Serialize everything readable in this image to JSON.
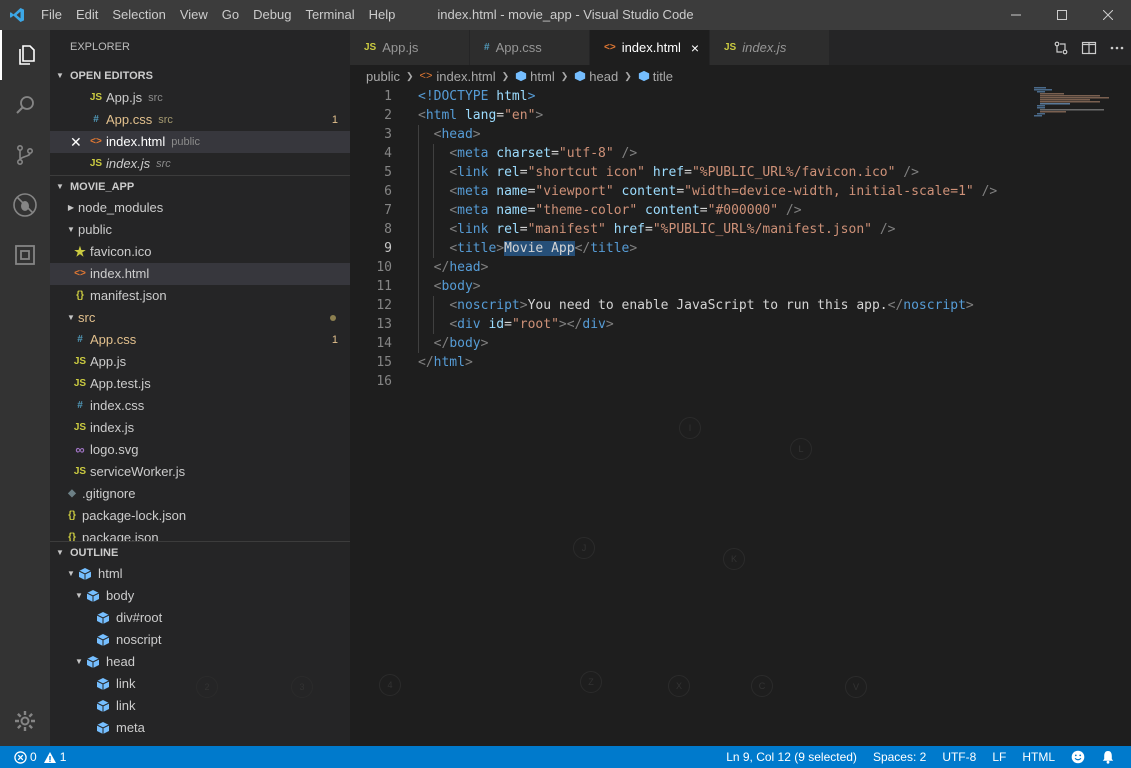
{
  "window": {
    "title": "index.html - movie_app - Visual Studio Code",
    "menu": [
      "File",
      "Edit",
      "Selection",
      "View",
      "Go",
      "Debug",
      "Terminal",
      "Help"
    ]
  },
  "activity": [
    "files-icon",
    "search-icon",
    "source-control-icon",
    "debug-icon",
    "extensions-icon",
    "gear-icon"
  ],
  "sidebar": {
    "title": "EXPLORER",
    "open_editors": {
      "header": "OPEN EDITORS",
      "items": [
        {
          "icon": "JS",
          "name": "App.js",
          "desc": "src",
          "badge": ""
        },
        {
          "icon": "#",
          "name": "App.css",
          "desc": "src",
          "badge": "1"
        },
        {
          "icon": "<>",
          "name": "index.html",
          "desc": "public",
          "badge": ""
        },
        {
          "icon": "JS",
          "name": "index.js",
          "desc": "src",
          "badge": ""
        }
      ]
    },
    "project": {
      "header": "MOVIE_APP",
      "items": [
        {
          "name": "node_modules"
        },
        {
          "name": "public"
        },
        {
          "icon": "★",
          "name": "favicon.ico"
        },
        {
          "icon": "<>",
          "name": "index.html"
        },
        {
          "icon": "{}",
          "name": "manifest.json"
        },
        {
          "name": "src"
        },
        {
          "icon": "#",
          "name": "App.css",
          "badge": "1"
        },
        {
          "icon": "JS",
          "name": "App.js"
        },
        {
          "icon": "JS",
          "name": "App.test.js"
        },
        {
          "icon": "#",
          "name": "index.css"
        },
        {
          "icon": "JS",
          "name": "index.js"
        },
        {
          "icon": "∞",
          "name": "logo.svg"
        },
        {
          "icon": "JS",
          "name": "serviceWorker.js"
        },
        {
          "icon": "◆",
          "name": ".gitignore"
        },
        {
          "icon": "{}",
          "name": "package-lock.json"
        },
        {
          "icon": "{}",
          "name": "package.json"
        }
      ]
    },
    "outline": {
      "header": "OUTLINE",
      "items": [
        "html",
        "body",
        "div#root",
        "noscript",
        "head",
        "link",
        "link",
        "meta"
      ]
    }
  },
  "tabs": [
    {
      "icon": "JS",
      "label": "App.js"
    },
    {
      "icon": "#",
      "label": "App.css"
    },
    {
      "icon": "<>",
      "label": "index.html",
      "close": "×"
    },
    {
      "icon": "JS",
      "label": "index.js"
    }
  ],
  "breadcrumbs": [
    "public",
    "index.html",
    "html",
    "head",
    "title"
  ],
  "editor": {
    "line_numbers": [
      "1",
      "2",
      "3",
      "4",
      "5",
      "6",
      "7",
      "8",
      "9",
      "10",
      "11",
      "12",
      "13",
      "14",
      "15",
      "16"
    ],
    "lines": [
      [
        [
          "t-tag",
          "<!DOCTYPE "
        ],
        [
          "t-attr",
          "html"
        ],
        [
          "t-tag",
          ">"
        ]
      ],
      [
        [
          "t-punc",
          "<"
        ],
        [
          "t-tag",
          "html "
        ],
        [
          "t-attr",
          "lang"
        ],
        [
          "t-txt",
          "="
        ],
        [
          "t-str",
          "\"en\""
        ],
        [
          "t-punc",
          ">"
        ]
      ],
      [
        [
          "t-txt",
          "  "
        ],
        [
          "t-punc",
          "<"
        ],
        [
          "t-tag",
          "head"
        ],
        [
          "t-punc",
          ">"
        ]
      ],
      [
        [
          "t-txt",
          "    "
        ],
        [
          "t-punc",
          "<"
        ],
        [
          "t-tag",
          "meta "
        ],
        [
          "t-attr",
          "charset"
        ],
        [
          "t-txt",
          "="
        ],
        [
          "t-str",
          "\"utf-8\""
        ],
        [
          "t-txt",
          " "
        ],
        [
          "t-punc",
          "/>"
        ]
      ],
      [
        [
          "t-txt",
          "    "
        ],
        [
          "t-punc",
          "<"
        ],
        [
          "t-tag",
          "link "
        ],
        [
          "t-attr",
          "rel"
        ],
        [
          "t-txt",
          "="
        ],
        [
          "t-str",
          "\"shortcut icon\""
        ],
        [
          "t-txt",
          " "
        ],
        [
          "t-attr",
          "href"
        ],
        [
          "t-txt",
          "="
        ],
        [
          "t-str",
          "\"%PUBLIC_URL%/favicon.ico\""
        ],
        [
          "t-txt",
          " "
        ],
        [
          "t-punc",
          "/>"
        ]
      ],
      [
        [
          "t-txt",
          "    "
        ],
        [
          "t-punc",
          "<"
        ],
        [
          "t-tag",
          "meta "
        ],
        [
          "t-attr",
          "name"
        ],
        [
          "t-txt",
          "="
        ],
        [
          "t-str",
          "\"viewport\""
        ],
        [
          "t-txt",
          " "
        ],
        [
          "t-attr",
          "content"
        ],
        [
          "t-txt",
          "="
        ],
        [
          "t-str",
          "\"width=device-width, initial-scale=1\""
        ],
        [
          "t-txt",
          " "
        ],
        [
          "t-punc",
          "/>"
        ]
      ],
      [
        [
          "t-txt",
          "    "
        ],
        [
          "t-punc",
          "<"
        ],
        [
          "t-tag",
          "meta "
        ],
        [
          "t-attr",
          "name"
        ],
        [
          "t-txt",
          "="
        ],
        [
          "t-str",
          "\"theme-color\""
        ],
        [
          "t-txt",
          " "
        ],
        [
          "t-attr",
          "content"
        ],
        [
          "t-txt",
          "="
        ],
        [
          "t-str",
          "\"#000000\""
        ],
        [
          "t-txt",
          " "
        ],
        [
          "t-punc",
          "/>"
        ]
      ],
      [
        [
          "t-txt",
          "    "
        ],
        [
          "t-punc",
          "<"
        ],
        [
          "t-tag",
          "link "
        ],
        [
          "t-attr",
          "rel"
        ],
        [
          "t-txt",
          "="
        ],
        [
          "t-str",
          "\"manifest\""
        ],
        [
          "t-txt",
          " "
        ],
        [
          "t-attr",
          "href"
        ],
        [
          "t-txt",
          "="
        ],
        [
          "t-str",
          "\"%PUBLIC_URL%/manifest.json\""
        ],
        [
          "t-txt",
          " "
        ],
        [
          "t-punc",
          "/>"
        ]
      ],
      [
        [
          "t-txt",
          "    "
        ],
        [
          "t-punc",
          "<"
        ],
        [
          "t-tag",
          "title"
        ],
        [
          "t-punc",
          ">"
        ],
        [
          "t-sel",
          "Movie App"
        ],
        [
          "t-punc",
          "</"
        ],
        [
          "t-tag",
          "title"
        ],
        [
          "t-punc",
          ">"
        ]
      ],
      [
        [
          "t-txt",
          "  "
        ],
        [
          "t-punc",
          "</"
        ],
        [
          "t-tag",
          "head"
        ],
        [
          "t-punc",
          ">"
        ]
      ],
      [
        [
          "t-txt",
          "  "
        ],
        [
          "t-punc",
          "<"
        ],
        [
          "t-tag",
          "body"
        ],
        [
          "t-punc",
          ">"
        ]
      ],
      [
        [
          "t-txt",
          "    "
        ],
        [
          "t-punc",
          "<"
        ],
        [
          "t-tag",
          "noscript"
        ],
        [
          "t-punc",
          ">"
        ],
        [
          "t-txt",
          "You need to enable JavaScript to run this app."
        ],
        [
          "t-punc",
          "</"
        ],
        [
          "t-tag",
          "noscript"
        ],
        [
          "t-punc",
          ">"
        ]
      ],
      [
        [
          "t-txt",
          "    "
        ],
        [
          "t-punc",
          "<"
        ],
        [
          "t-tag",
          "div "
        ],
        [
          "t-attr",
          "id"
        ],
        [
          "t-txt",
          "="
        ],
        [
          "t-str",
          "\"root\""
        ],
        [
          "t-punc",
          "></"
        ],
        [
          "t-tag",
          "div"
        ],
        [
          "t-punc",
          ">"
        ]
      ],
      [
        [
          "t-txt",
          "  "
        ],
        [
          "t-punc",
          "</"
        ],
        [
          "t-tag",
          "body"
        ],
        [
          "t-punc",
          ">"
        ]
      ],
      [
        [
          "t-punc",
          "</"
        ],
        [
          "t-tag",
          "html"
        ],
        [
          "t-punc",
          ">"
        ]
      ],
      []
    ],
    "current_line": "9"
  },
  "hints": [
    "I",
    "L",
    "J",
    "K",
    "2",
    "3",
    "4",
    "Z",
    "X",
    "C",
    "V"
  ],
  "status": {
    "errors": "0",
    "warnings": "1",
    "position": "Ln 9, Col 12 (9 selected)",
    "spaces": "Spaces: 2",
    "encoding": "UTF-8",
    "eol": "LF",
    "language": "HTML"
  },
  "colors": {
    "accent": "#007acc",
    "js": "#cbcb41",
    "css": "#519aba",
    "html": "#e37933"
  }
}
